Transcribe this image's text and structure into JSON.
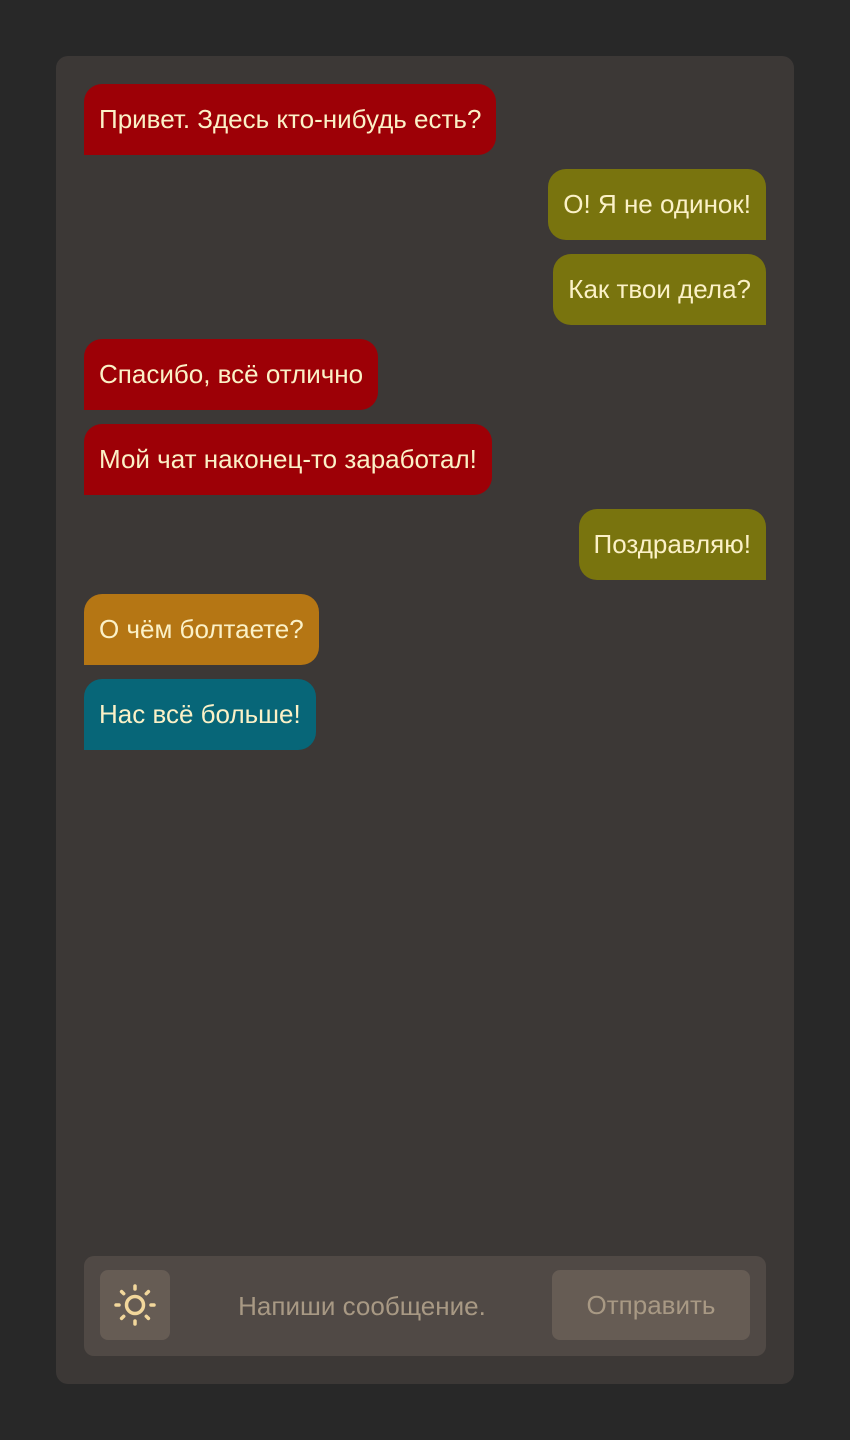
{
  "messages": [
    {
      "text": "Привет. Здесь кто-нибудь есть?",
      "side": "left",
      "color": "#9d0006"
    },
    {
      "text": "О! Я не одинок!",
      "side": "right",
      "color": "#79740e"
    },
    {
      "text": "Как твои дела?",
      "side": "right",
      "color": "#79740e"
    },
    {
      "text": "Спасибо, всё отлично",
      "side": "left",
      "color": "#9d0006"
    },
    {
      "text": "Мой чат наконец-то заработал!",
      "side": "left",
      "color": "#9d0006"
    },
    {
      "text": "Поздравляю!",
      "side": "right",
      "color": "#79740e"
    },
    {
      "text": "О чём болтаете?",
      "side": "left",
      "color": "#b57614"
    },
    {
      "text": "Нас всё больше!",
      "side": "left",
      "color": "#076678"
    }
  ],
  "composer": {
    "theme_icon": "sun-icon",
    "placeholder": "Напиши сообщение.",
    "value": "",
    "send_label": "Отправить"
  },
  "colors": {
    "page_bg": "#282828",
    "app_bg": "#3c3836",
    "composer_bg": "#504945",
    "button_bg": "#665c54",
    "text": "#fbf1c7",
    "muted_text": "#a89984",
    "icon": "#f2d79b"
  }
}
